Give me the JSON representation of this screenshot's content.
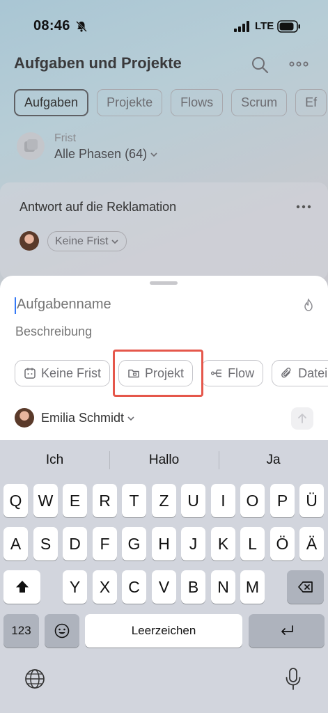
{
  "status_bar": {
    "time": "08:46",
    "network": "LTE"
  },
  "header": {
    "title": "Aufgaben und Projekte"
  },
  "tabs": [
    "Aufgaben",
    "Projekte",
    "Flows",
    "Scrum",
    "Ef"
  ],
  "filter": {
    "caption": "Frist",
    "value": "Alle Phasen (64)"
  },
  "task": {
    "title": "Antwort auf die Reklamation",
    "deadline_chip": "Keine Frist"
  },
  "sheet": {
    "task_name_placeholder": "Aufgabenname",
    "description_placeholder": "Beschreibung",
    "chips": [
      "Keine Frist",
      "Projekt",
      "Flow",
      "Datei"
    ],
    "assignee": "Emilia Schmidt"
  },
  "keyboard": {
    "suggestions": [
      "Ich",
      "Hallo",
      "Ja"
    ],
    "row1": [
      "Q",
      "W",
      "E",
      "R",
      "T",
      "Z",
      "U",
      "I",
      "O",
      "P",
      "Ü"
    ],
    "row2": [
      "A",
      "S",
      "D",
      "F",
      "G",
      "H",
      "J",
      "K",
      "L",
      "Ö",
      "Ä"
    ],
    "row3": [
      "Y",
      "X",
      "C",
      "V",
      "B",
      "N",
      "M"
    ],
    "numbers_label": "123",
    "space_label": "Leerzeichen"
  },
  "colors": {
    "accent_cursor": "#3478f6",
    "highlight": "#e5574b"
  }
}
